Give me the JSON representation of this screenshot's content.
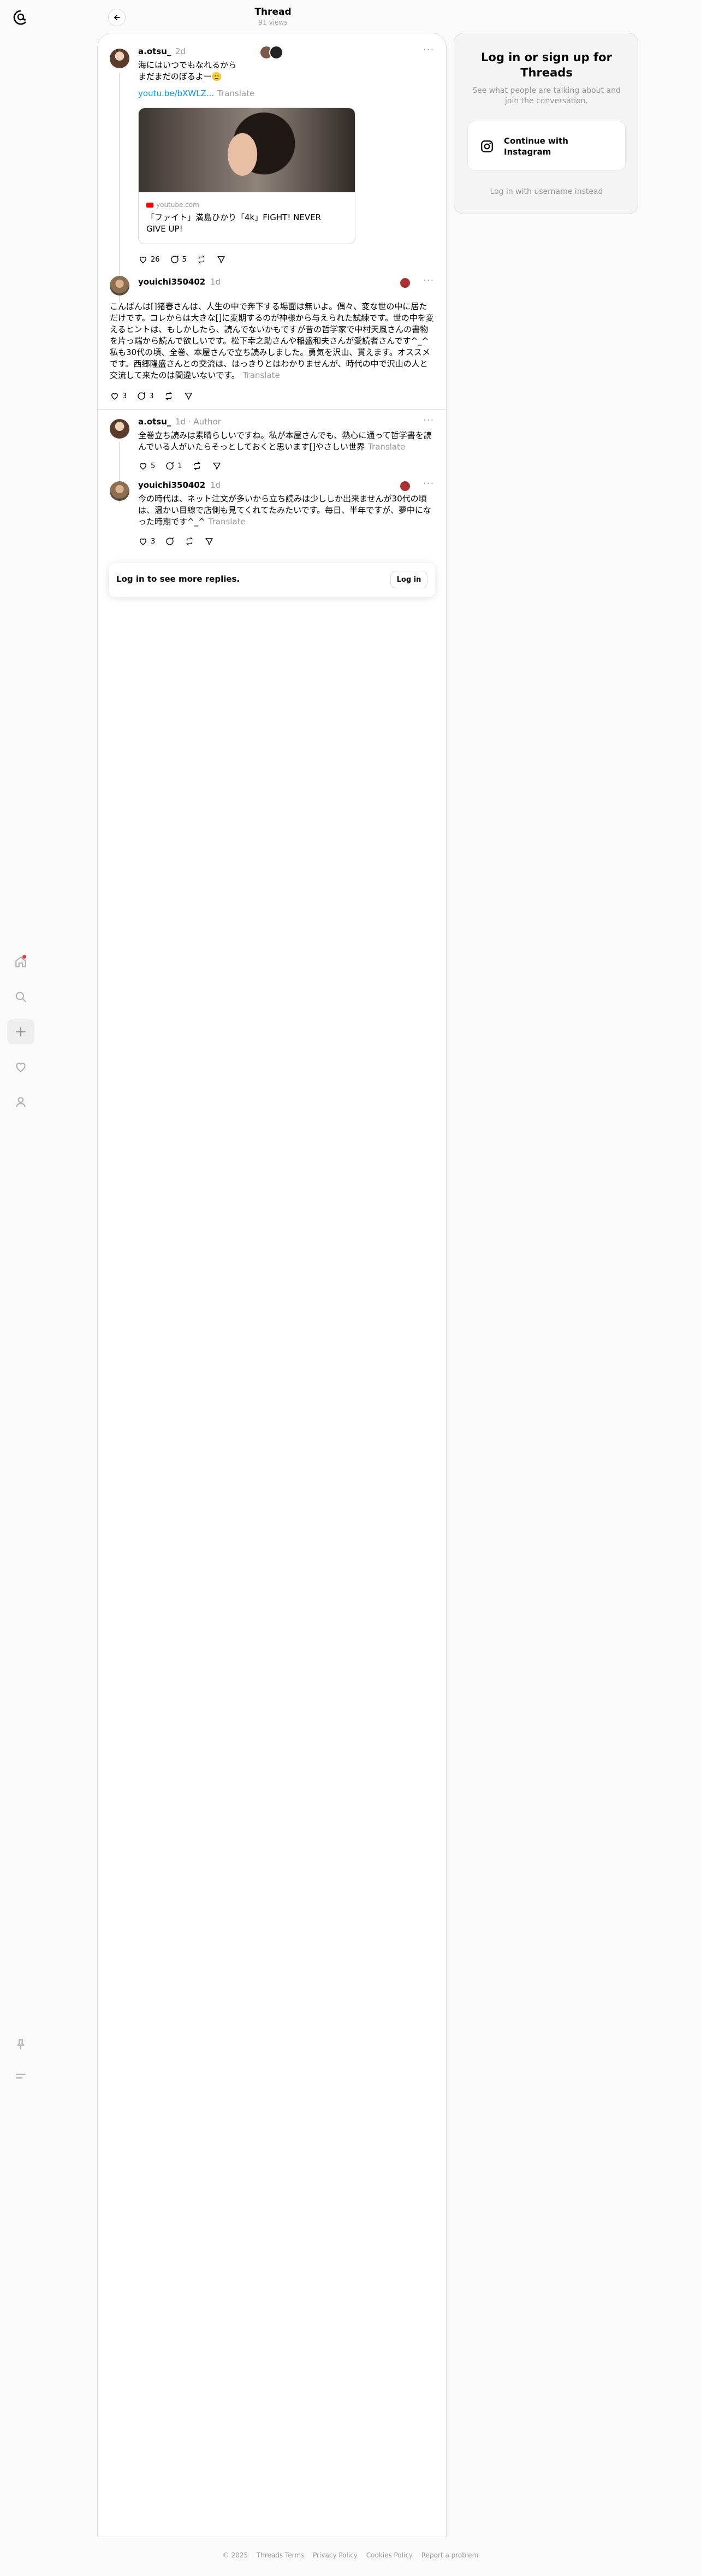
{
  "header": {
    "title": "Thread",
    "views": "91 views"
  },
  "nav": {
    "items": [
      "home",
      "search",
      "create",
      "activity",
      "profile"
    ],
    "bottom": [
      "pin",
      "menu"
    ]
  },
  "posts": [
    {
      "username": "a.otsu_",
      "time": "2d",
      "text": "海にはいつでもなれるから\nまだまだのぼるよー🫡",
      "link": "youtu.be/bXWLZ...",
      "translate": "Translate",
      "card": {
        "domain": "youtube.com",
        "title": "「ファイト」満島ひかり「4k」FIGHT! NEVER GIVE UP!"
      },
      "likes": "26",
      "replies": "5"
    },
    {
      "username": "youichi350402",
      "time": "1d",
      "text": "こんばんは[]猪春さんは、人生の中で奔下する場面は無いよ。偶々、変な世の中に居ただけです。コレからは大きな[]に変期するのが神様から与えられた試練です。世の中を変えるヒントは、もしかしたら、読んでないかもですが昔の哲学家で中村天風さんの書物を片っ端から読んで欲しいです。松下幸之助さんや稲盛和夫さんが愛読者さんです^_^私も30代の頃、全巻、本屋さんで立ち読みしました。勇気を沢山、貰えます。オススメです。西郷隆盛さんとの交流は、はっきりとはわかりませんが、時代の中で沢山の人と交流して来たのは間違いないです。",
      "translate": "Translate",
      "likes": "3",
      "replies": "3"
    },
    {
      "username": "a.otsu_",
      "time": "1d",
      "badge": "Author",
      "text": "全巻立ち読みは素晴らしいですね。私が本屋さんでも、熱心に通って哲学書を読んでいる人がいたらそっとしておくと思います[]やさしい世界",
      "translate": "Translate",
      "likes": "5",
      "replies": "1"
    },
    {
      "username": "youichi350402",
      "time": "1d",
      "text": "今の時代は、ネット注文が多いから立ち読みは少ししか出来ませんが30代の頃は、温かい目線で店側も見てくれてたみたいです。毎日、半年ですが、夢中になった時期です^_^",
      "translate": "Translate",
      "likes": "3"
    }
  ],
  "login_bar": {
    "text": "Log in to see more replies.",
    "button": "Log in"
  },
  "panel": {
    "title": "Log in or sign up for Threads",
    "subtitle": "See what people are talking about and join the conversation.",
    "instagram_button": "Continue with Instagram",
    "alt_login": "Log in with username instead"
  },
  "footer": {
    "items": [
      "© 2025",
      "Threads Terms",
      "Privacy Policy",
      "Cookies Policy",
      "Report a problem"
    ]
  },
  "colors": {
    "background": "#fafafa",
    "card": "#ffffff",
    "muted_text": "#999999",
    "link": "#0095f6",
    "notification_dot": "#ff3040"
  }
}
